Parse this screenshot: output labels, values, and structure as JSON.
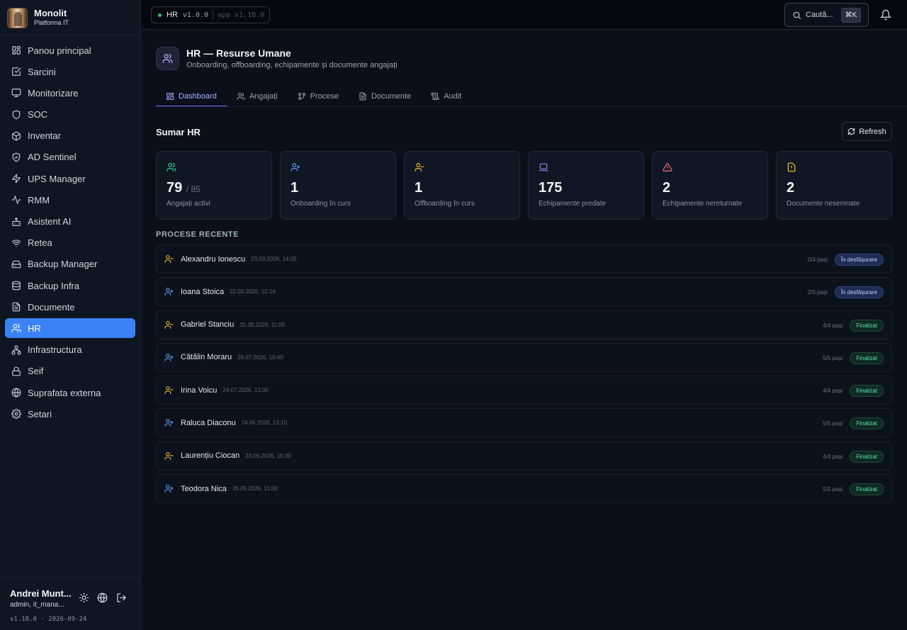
{
  "brand": {
    "name": "Monolit",
    "subtitle": "Platforma IT"
  },
  "colors": {
    "accent": "#3b82f6",
    "tab_accent": "#6366f1",
    "onboarding": "#60a5fa",
    "offboarding": "#fbbf24",
    "success": "#22c55e"
  },
  "sidebar": {
    "items": [
      {
        "label": "Panou principal",
        "icon": "dashboard-icon"
      },
      {
        "label": "Sarcini",
        "icon": "tasks-icon"
      },
      {
        "label": "Monitorizare",
        "icon": "monitor-icon"
      },
      {
        "label": "SOC",
        "icon": "shield-icon"
      },
      {
        "label": "Inventar",
        "icon": "package-icon"
      },
      {
        "label": "AD Sentinel",
        "icon": "shield-check-icon"
      },
      {
        "label": "UPS Manager",
        "icon": "zap-icon"
      },
      {
        "label": "RMM",
        "icon": "activity-icon"
      },
      {
        "label": "Asistent AI",
        "icon": "bot-icon"
      },
      {
        "label": "Retea",
        "icon": "wifi-icon"
      },
      {
        "label": "Backup Manager",
        "icon": "hard-drive-icon"
      },
      {
        "label": "Backup Infra",
        "icon": "database-icon"
      },
      {
        "label": "Documente",
        "icon": "file-text-icon"
      },
      {
        "label": "HR",
        "icon": "users-icon",
        "active": true
      },
      {
        "label": "Infrastructura",
        "icon": "network-icon"
      },
      {
        "label": "Seif",
        "icon": "lock-icon"
      },
      {
        "label": "Suprafata externa",
        "icon": "globe-icon"
      },
      {
        "label": "Setari",
        "icon": "settings-icon"
      }
    ],
    "user": {
      "name": "Andrei Munt...",
      "role": "admin, it_mana..."
    },
    "version_line": "v1.18.0 · 2026-09-24"
  },
  "topbar": {
    "module": "HR",
    "module_version": "v1.0.0",
    "app_version": "app v1.18.0",
    "search_placeholder": "Caută...",
    "search_shortcut": "⌘K"
  },
  "page": {
    "title": "HR — Resurse Umane",
    "subtitle": "Onboarding, offboarding, echipamente și documente angajați",
    "tabs": [
      {
        "label": "Dashboard",
        "icon": "dashboard-icon",
        "active": true
      },
      {
        "label": "Angajați",
        "icon": "users-icon"
      },
      {
        "label": "Procese",
        "icon": "git-branch-icon"
      },
      {
        "label": "Documente",
        "icon": "file-text-icon"
      },
      {
        "label": "Audit",
        "icon": "scroll-icon"
      }
    ],
    "summary_title": "Sumar HR",
    "refresh_label": "Refresh",
    "cards": [
      {
        "value": "79",
        "total": "/ 85",
        "label": "Angajați activi",
        "icon": "users-icon",
        "color": "#34d399"
      },
      {
        "value": "1",
        "label": "Onboarding în curs",
        "icon": "user-plus-icon",
        "color": "#60a5fa"
      },
      {
        "value": "1",
        "label": "Offboarding în curs",
        "icon": "user-minus-icon",
        "color": "#fbbf24"
      },
      {
        "value": "175",
        "label": "Echipamente predate",
        "icon": "laptop-icon",
        "color": "#818cf8"
      },
      {
        "value": "2",
        "label": "Echipamente nereturnate",
        "icon": "alert-triangle-icon",
        "color": "#f87171"
      },
      {
        "value": "2",
        "label": "Documente nesemnate",
        "icon": "file-warning-icon",
        "color": "#facc15"
      }
    ],
    "recent_title": "PROCESE RECENTE",
    "processes": [
      {
        "name": "Alexandru Ionescu",
        "date": "23.09.2026, 14:05",
        "steps": "0/4 pași",
        "status": "În desfășurare",
        "type": "offboarding"
      },
      {
        "name": "Ioana Stoica",
        "date": "22.09.2026, 10:14",
        "steps": "2/5 pași",
        "status": "În desfășurare",
        "type": "onboarding"
      },
      {
        "name": "Gabriel Stanciu",
        "date": "25.08.2026, 11:00",
        "steps": "4/4 pași",
        "status": "Finalizat",
        "type": "offboarding"
      },
      {
        "name": "Cătălin Moraru",
        "date": "28.07.2026, 10:40",
        "steps": "5/5 pași",
        "status": "Finalizat",
        "type": "onboarding"
      },
      {
        "name": "Irina Voicu",
        "date": "24.07.2026, 13:00",
        "steps": "4/4 pași",
        "status": "Finalizat",
        "type": "offboarding"
      },
      {
        "name": "Raluca Diaconu",
        "date": "24.06.2026, 12:10",
        "steps": "5/5 pași",
        "status": "Finalizat",
        "type": "onboarding"
      },
      {
        "name": "Laurențiu Ciocan",
        "date": "23.06.2026, 10:30",
        "steps": "4/4 pași",
        "status": "Finalizat",
        "type": "offboarding"
      },
      {
        "name": "Teodora Nica",
        "date": "26.05.2026, 11:00",
        "steps": "5/5 pași",
        "status": "Finalizat",
        "type": "onboarding"
      }
    ]
  }
}
